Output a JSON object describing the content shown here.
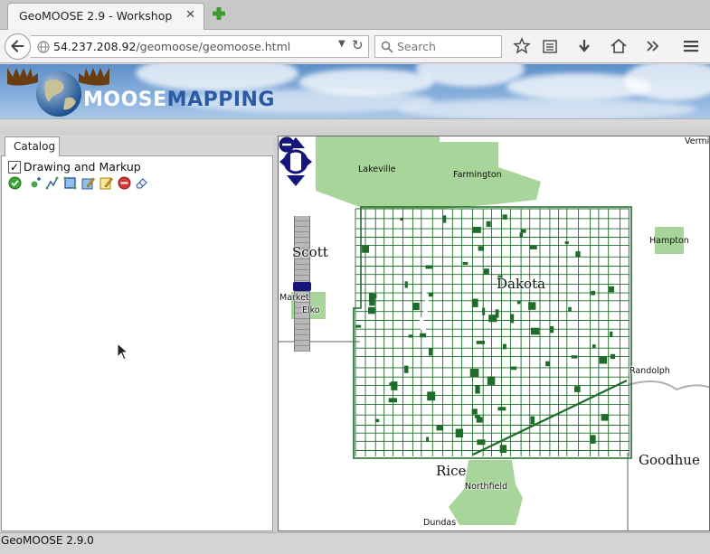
{
  "browser": {
    "tab_title": "GeoMOOSE 2.9 - Workshop",
    "url_host": "54.237.208.92",
    "url_path": "/geomoose/geomoose.html",
    "search_placeholder": "Search"
  },
  "header": {
    "logo_moose": "MOOSE",
    "logo_mapping": "MAPPING"
  },
  "catalog": {
    "tab_label": "Catalog",
    "layer_label": "Drawing and Markup",
    "layer_checked": true,
    "check_mark": "✓"
  },
  "map": {
    "labels": {
      "lakeville": "Lakeville",
      "farmington": "Farmington",
      "vermillion": "Vermi",
      "hampton": "Hampton",
      "scott": "Scott",
      "dakota": "Dakota",
      "market": "Market",
      "elko": "Elko",
      "randolph": "Randolph",
      "goodhue": "Goodhue",
      "rice": "Rice",
      "northfield": "Northfield",
      "dundas": "Dundas"
    },
    "colors": {
      "parcel": "#1e6b2a",
      "city": "#a8d59a",
      "road": "#b0b0b0"
    }
  },
  "status": {
    "text": "GeoMOOSE 2.9.0"
  }
}
